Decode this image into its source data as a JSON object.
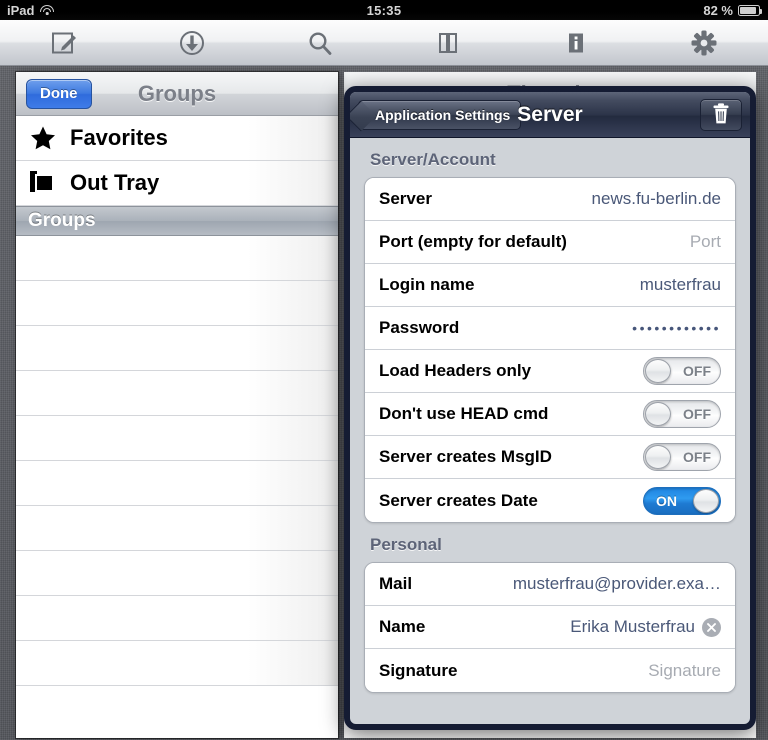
{
  "status_bar": {
    "carrier": "iPad",
    "wifi_icon": "wifi-icon",
    "time": "15:35",
    "battery_percent": "82 %",
    "battery_icon": "battery-icon"
  },
  "toolbar": {
    "buttons": [
      {
        "name": "compose-icon",
        "label": "Compose"
      },
      {
        "name": "download-icon",
        "label": "Download"
      },
      {
        "name": "search-icon",
        "label": "Search"
      },
      {
        "name": "columns-icon",
        "label": "Layout"
      },
      {
        "name": "info-icon",
        "label": "Info"
      },
      {
        "name": "gear-icon",
        "label": "Settings"
      }
    ]
  },
  "left_panel": {
    "done_label": "Done",
    "title": "Groups",
    "rows": [
      {
        "icon": "star-icon",
        "label": "Favorites"
      },
      {
        "icon": "tray-icon",
        "label": "Out Tray"
      }
    ],
    "section_label": "Groups",
    "empty_row_count": 10
  },
  "threads_panel": {
    "title": "Threads"
  },
  "popover": {
    "back_label": "Application Settings",
    "title": "Server",
    "delete_icon": "trash-icon",
    "sections": [
      {
        "header": "Server/Account",
        "rows": [
          {
            "label": "Server",
            "type": "text",
            "value": "news.fu-berlin.de",
            "placeholder": ""
          },
          {
            "label": "Port (empty for default)",
            "type": "text",
            "value": "",
            "placeholder": "Port"
          },
          {
            "label": "Login name",
            "type": "text",
            "value": "musterfrau",
            "placeholder": ""
          },
          {
            "label": "Password",
            "type": "password",
            "value": "••••••••••••",
            "placeholder": ""
          },
          {
            "label": "Load Headers only",
            "type": "toggle",
            "state": "OFF"
          },
          {
            "label": "Don't use HEAD cmd",
            "type": "toggle",
            "state": "OFF"
          },
          {
            "label": "Server creates MsgID",
            "type": "toggle",
            "state": "OFF"
          },
          {
            "label": "Server creates Date",
            "type": "toggle",
            "state": "ON"
          }
        ]
      },
      {
        "header": "Personal",
        "rows": [
          {
            "label": "Mail",
            "type": "text",
            "value": "musterfrau@provider.exa…",
            "placeholder": ""
          },
          {
            "label": "Name",
            "type": "text-clear",
            "value": "Erika Musterfrau",
            "placeholder": "",
            "clear_icon": "clear-icon"
          },
          {
            "label": "Signature",
            "type": "text",
            "value": "",
            "placeholder": "Signature"
          }
        ]
      }
    ]
  },
  "colors": {
    "accent_blue": "#2f6bdc",
    "toggle_on": "#1f84e0",
    "value_text": "#4a5878",
    "nav_dark": "#2b3348"
  }
}
